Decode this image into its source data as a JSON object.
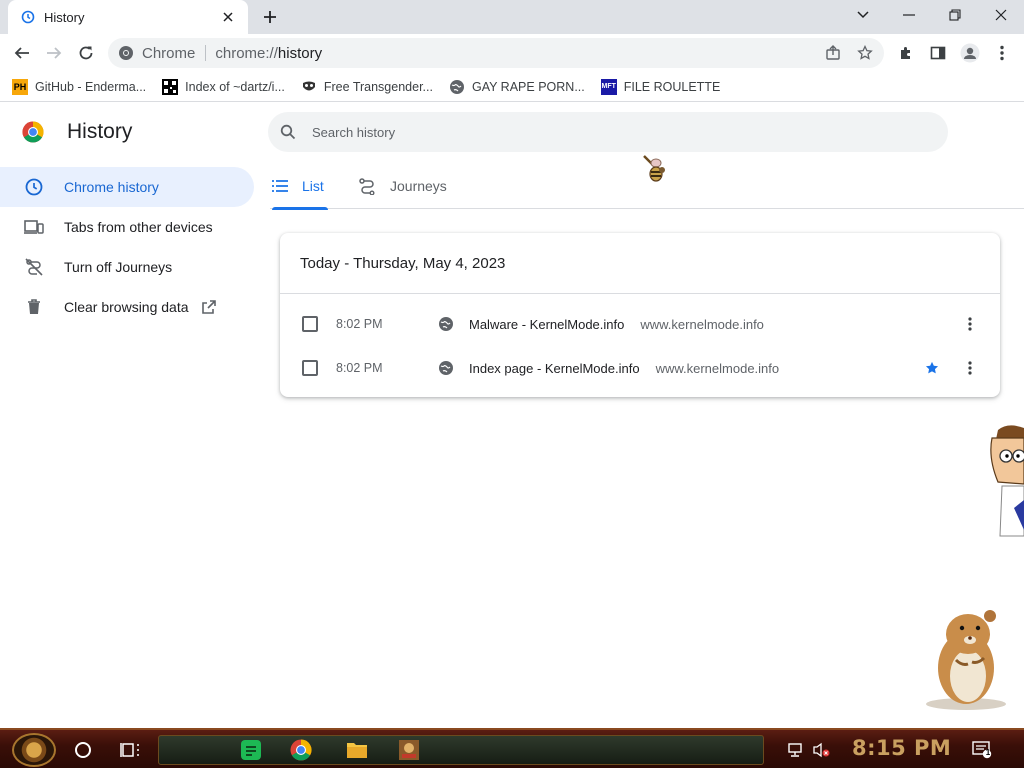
{
  "browser": {
    "tab": {
      "title": "History"
    },
    "omnibox": {
      "chip": "Chrome",
      "url_scheme": "chrome://",
      "url_path": "history"
    },
    "bookmarks": [
      {
        "label": "GitHub - Enderma...",
        "icon": "ph-icon"
      },
      {
        "label": "Index of ~dartz/i...",
        "icon": "qr-icon"
      },
      {
        "label": "Free Transgender...",
        "icon": "mask-icon"
      },
      {
        "label": "GAY RAPE PORN...",
        "icon": "globe-icon"
      },
      {
        "label": "FILE ROULETTE",
        "icon": "mft-icon"
      }
    ]
  },
  "page": {
    "title": "History",
    "search_placeholder": "Search history",
    "nav": [
      {
        "label": "Chrome history",
        "icon": "clock-icon",
        "active": true
      },
      {
        "label": "Tabs from other devices",
        "icon": "devices-icon",
        "active": false
      },
      {
        "label": "Turn off Journeys",
        "icon": "journeys-off-icon",
        "active": false
      },
      {
        "label": "Clear browsing data",
        "icon": "trash-icon",
        "active": false
      }
    ],
    "tabs": [
      {
        "label": "List",
        "active": true
      },
      {
        "label": "Journeys",
        "active": false
      }
    ],
    "history": {
      "date_header": "Today - Thursday, May 4, 2023",
      "entries": [
        {
          "time": "8:02 PM",
          "title": "Malware - KernelMode.info",
          "domain": "www.kernelmode.info",
          "starred": false
        },
        {
          "time": "8:02 PM",
          "title": "Index page - KernelMode.info",
          "domain": "www.kernelmode.info",
          "starred": true
        }
      ]
    }
  },
  "taskbar": {
    "clock": "8:15 PM",
    "notification_count": "1"
  },
  "colors": {
    "accent": "#1a73e8",
    "active_nav_bg": "#e8f0fe",
    "tabstrip_bg": "#dee1e6",
    "taskbar_bg": "#3a0f08",
    "clock_color": "#c9a060"
  }
}
